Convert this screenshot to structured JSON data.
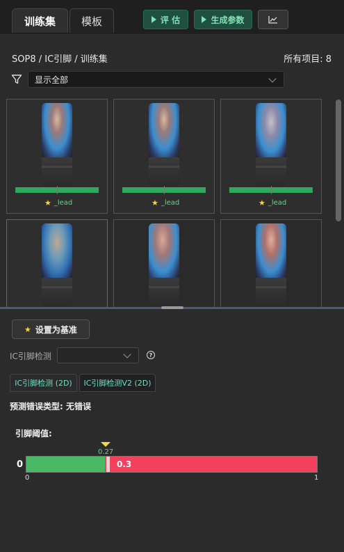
{
  "tabs": [
    {
      "label": "训练集",
      "active": true
    },
    {
      "label": "模板",
      "active": false
    }
  ],
  "toolbar": {
    "evaluate_label": "评 估",
    "generate_label": "生成参数",
    "chart_icon": "line-chart-icon"
  },
  "breadcrumb": "SOP8 / IC引脚 / 训练集",
  "count_label": "所有项目: 8",
  "filter": {
    "icon": "filter-icon",
    "selected": "显示全部"
  },
  "gallery": {
    "items": [
      {
        "label": "_lead",
        "starred": true
      },
      {
        "label": "_lead",
        "starred": true
      },
      {
        "label": "_lead",
        "starred": true
      },
      {
        "label": "",
        "starred": false
      },
      {
        "label": "",
        "starred": false
      },
      {
        "label": "",
        "starred": false
      }
    ]
  },
  "set_base_label": "设置为基准",
  "detector": {
    "label": "IC引脚检测",
    "selected": "",
    "help": "?"
  },
  "subtabs": [
    "IC引脚检测 (2D)",
    "IC引脚检测V2 (2D)"
  ],
  "prediction_error": "预测错误类型: 无错误",
  "threshold": {
    "title": "引脚阈值:",
    "left_value": "0",
    "value": 0.3,
    "value_label": "0.3",
    "marker": 0.27,
    "marker_label": "0.27",
    "min_label": "0",
    "max_label": "1",
    "colors": {
      "pass": "#49ba63",
      "fail": "#f4405d",
      "marker": "#f2d54a"
    }
  }
}
